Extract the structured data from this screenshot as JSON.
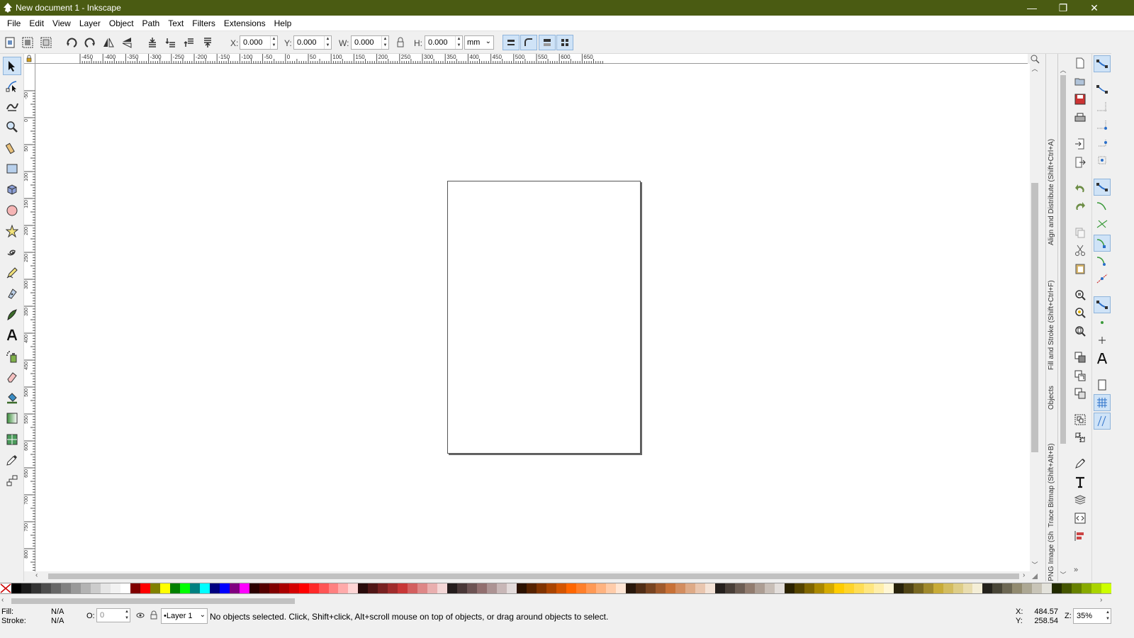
{
  "window": {
    "title": "New document 1 - Inkscape",
    "min_glyph": "—",
    "max_glyph": "❐",
    "close_glyph": "✕"
  },
  "menu": [
    "File",
    "Edit",
    "View",
    "Layer",
    "Object",
    "Path",
    "Text",
    "Filters",
    "Extensions",
    "Help"
  ],
  "toolbar": {
    "x_label": "X:",
    "x_value": "0.000",
    "y_label": "Y:",
    "y_value": "0.000",
    "w_label": "W:",
    "w_value": "0.000",
    "h_label": "H:",
    "h_value": "0.000",
    "unit": "mm"
  },
  "ruler": {
    "h_ticks": [
      "-450",
      "-400",
      "-350",
      "-300",
      "-250",
      "-200",
      "-150",
      "-100",
      "-50",
      "0",
      "50",
      "100",
      "150",
      "200",
      "250",
      "300",
      "350",
      "400",
      "450",
      "500",
      "550",
      "600",
      "650"
    ],
    "v_ticks": [
      "-50",
      "0",
      "50",
      "100",
      "150",
      "200",
      "250",
      "300",
      "350",
      "400",
      "450",
      "500",
      "550",
      "600",
      "650",
      "700",
      "750",
      "800"
    ]
  },
  "docks": [
    "Align and Distribute (Shift+Ctrl+A)",
    "Fill and Stroke (Shift+Ctrl+F)",
    "Objects",
    "Trace Bitmap (Shift+Alt+B)",
    "PNG Image (Shift+Ctrl+E)"
  ],
  "status": {
    "fill_label": "Fill:",
    "fill_value": "N/A",
    "stroke_label": "Stroke:",
    "stroke_value": "N/A",
    "opacity_label": "O:",
    "opacity_value": "0",
    "layer": "•Layer 1",
    "message": "No objects selected. Click, Shift+click, Alt+scroll mouse on top of objects, or drag around objects to select.",
    "x_label": "X:",
    "x_value": "484.57",
    "y_label": "Y:",
    "y_value": "258.54",
    "zoom_label": "Z:",
    "zoom_value": "35%"
  },
  "palette": [
    "#000000",
    "#1a1a1a",
    "#333333",
    "#4d4d4d",
    "#666666",
    "#808080",
    "#999999",
    "#b3b3b3",
    "#cccccc",
    "#e6e6e6",
    "#f2f2f2",
    "#ffffff",
    "#800000",
    "#ff0000",
    "#808000",
    "#ffff00",
    "#008000",
    "#00ff00",
    "#008080",
    "#00ffff",
    "#000080",
    "#0000ff",
    "#800080",
    "#ff00ff",
    "#2b0000",
    "#550000",
    "#800000",
    "#aa0000",
    "#d40000",
    "#ff0000",
    "#ff2a2a",
    "#ff5555",
    "#ff8080",
    "#ffaaaa",
    "#ffd5d5",
    "#280b0b",
    "#501616",
    "#782121",
    "#a02c2c",
    "#c83737",
    "#d35f5f",
    "#de8787",
    "#e9afaf",
    "#f4d7d7",
    "#241c1c",
    "#483737",
    "#6c5353",
    "#916f6f",
    "#ac9393",
    "#c8b7b7",
    "#e3dbdb",
    "#2b1100",
    "#552200",
    "#803300",
    "#aa4400",
    "#d45500",
    "#ff6600",
    "#ff7f2a",
    "#ff9955",
    "#ffb380",
    "#ffccaa",
    "#ffe6d5",
    "#28170b",
    "#502d16",
    "#784421",
    "#a05a2c",
    "#c87137",
    "#d38d5f",
    "#deaa87",
    "#e9c6af",
    "#f4e3d7",
    "#241f1c",
    "#483e37",
    "#6c5d53",
    "#917c6f",
    "#ac9d93",
    "#c8beb7",
    "#e3dedb",
    "#2b2200",
    "#554400",
    "#806600",
    "#aa8800",
    "#d4aa00",
    "#ffcc00",
    "#ffd42a",
    "#ffdd55",
    "#ffe680",
    "#ffeeaa",
    "#fff6d5",
    "#28220b",
    "#504416",
    "#786721",
    "#a0892c",
    "#c8ab37",
    "#d3bc5f",
    "#decd87",
    "#e9ddaf",
    "#f4eed7",
    "#24221c",
    "#484537",
    "#6c6753",
    "#918a6f",
    "#aca793",
    "#c8c4b7",
    "#e3e2db",
    "#222b00",
    "#445500",
    "#668000",
    "#88aa00",
    "#aad400",
    "#ccff00"
  ]
}
